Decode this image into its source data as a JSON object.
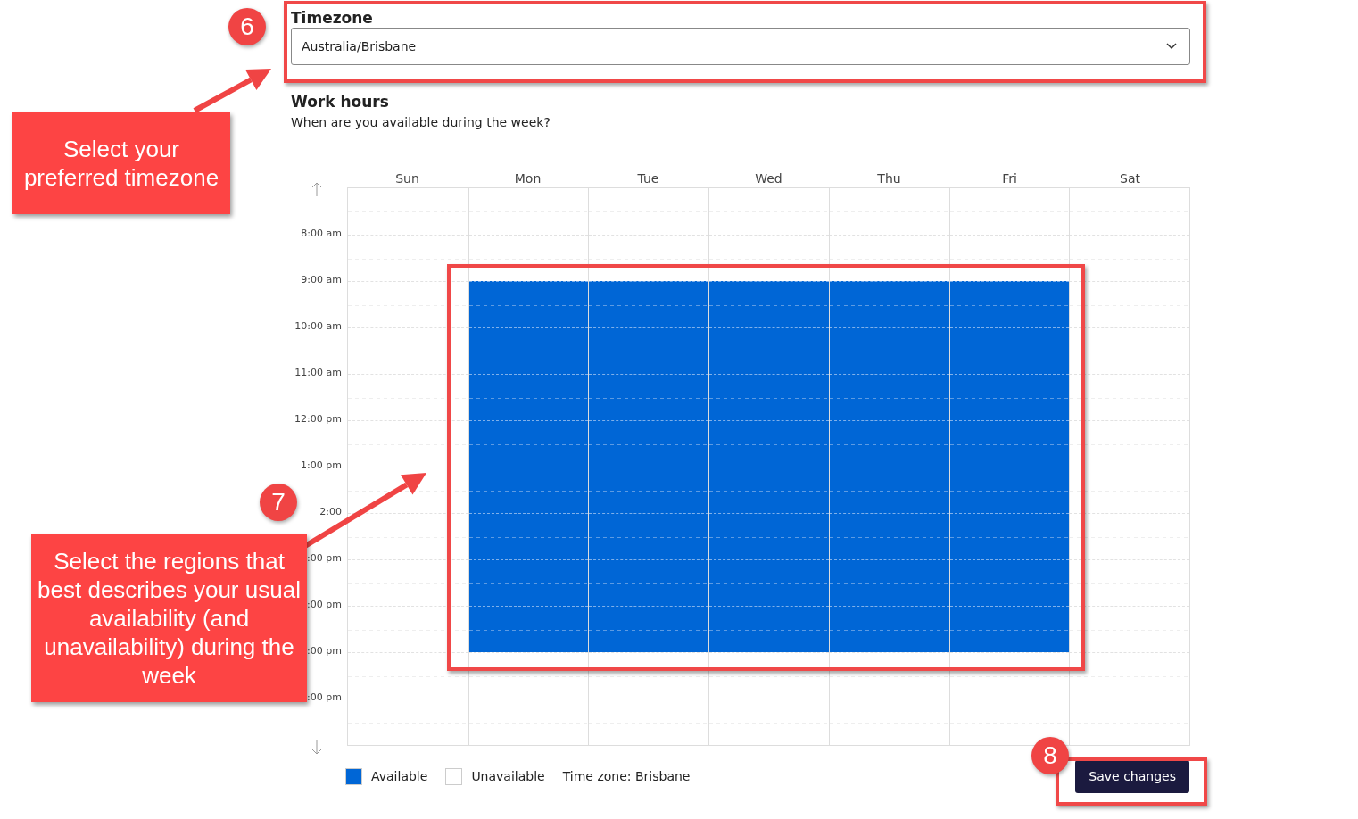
{
  "timezone": {
    "label": "Timezone",
    "value": "Australia/Brisbane"
  },
  "work_hours": {
    "title": "Work hours",
    "subtitle": "When are you available during the week?"
  },
  "days": [
    {
      "label": "Sun",
      "slots": [
        false,
        false,
        false,
        false,
        false,
        false,
        false,
        false,
        false,
        false,
        false,
        false
      ]
    },
    {
      "label": "Mon",
      "slots": [
        false,
        false,
        true,
        true,
        true,
        true,
        true,
        true,
        true,
        true,
        false,
        false
      ]
    },
    {
      "label": "Tue",
      "slots": [
        false,
        false,
        true,
        true,
        true,
        true,
        true,
        true,
        true,
        true,
        false,
        false
      ]
    },
    {
      "label": "Wed",
      "slots": [
        false,
        false,
        true,
        true,
        true,
        true,
        true,
        true,
        true,
        true,
        false,
        false
      ]
    },
    {
      "label": "Thu",
      "slots": [
        false,
        false,
        true,
        true,
        true,
        true,
        true,
        true,
        true,
        true,
        false,
        false
      ]
    },
    {
      "label": "Fri",
      "slots": [
        false,
        false,
        true,
        true,
        true,
        true,
        true,
        true,
        true,
        true,
        false,
        false
      ]
    },
    {
      "label": "Sat",
      "slots": [
        false,
        false,
        false,
        false,
        false,
        false,
        false,
        false,
        false,
        false,
        false,
        false
      ]
    }
  ],
  "time_labels": [
    "8:00 am",
    "9:00 am",
    "10:00 am",
    "11:00 am",
    "12:00 pm",
    "1:00 pm",
    "2:00",
    ":00 pm",
    ":00 pm",
    ":00 pm",
    ":00 pm"
  ],
  "legend": [
    {
      "label": "Available",
      "kind": "available"
    },
    {
      "label": "Unavailable",
      "kind": "unavailable"
    },
    {
      "label": "Time zone: Brisbane",
      "kind": "text"
    }
  ],
  "save_button": "Save changes",
  "annotations": [
    {
      "number": "6",
      "text": "Select your preferred timezone"
    },
    {
      "number": "7",
      "text": "Select the regions that best describes your usual availability (and unavailability) during the week"
    },
    {
      "number": "8"
    }
  ]
}
